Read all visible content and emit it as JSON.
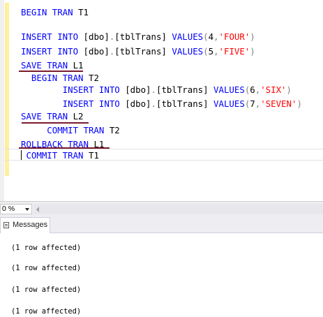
{
  "editor": {
    "lines": [
      {
        "tokens": [
          {
            "t": "BEGIN TRAN",
            "c": "kw"
          },
          {
            "t": " T1",
            "c": "obj"
          }
        ]
      },
      {
        "tokens": [
          {
            "t": "INSERT INTO",
            "c": "kw"
          },
          {
            "t": " [dbo]",
            "c": "obj"
          },
          {
            "t": ".",
            "c": "punc"
          },
          {
            "t": "[tblTrans] ",
            "c": "obj"
          },
          {
            "t": "VALUES",
            "c": "kw"
          },
          {
            "t": "(",
            "c": "punc"
          },
          {
            "t": "4",
            "c": "num"
          },
          {
            "t": ",",
            "c": "punc"
          },
          {
            "t": "'FOUR'",
            "c": "str"
          },
          {
            "t": ")",
            "c": "punc"
          }
        ]
      },
      {
        "tokens": [
          {
            "t": "INSERT INTO",
            "c": "kw"
          },
          {
            "t": " [dbo]",
            "c": "obj"
          },
          {
            "t": ".",
            "c": "punc"
          },
          {
            "t": "[tblTrans] ",
            "c": "obj"
          },
          {
            "t": "VALUES",
            "c": "kw"
          },
          {
            "t": "(",
            "c": "punc"
          },
          {
            "t": "5",
            "c": "num"
          },
          {
            "t": ",",
            "c": "punc"
          },
          {
            "t": "'FIVE'",
            "c": "str"
          },
          {
            "t": ")",
            "c": "punc"
          }
        ]
      },
      {
        "tokens": [
          {
            "t": "SAVE TRAN",
            "c": "kw"
          },
          {
            "t": " L1",
            "c": "obj"
          }
        ]
      },
      {
        "tokens": [
          {
            "t": "  BEGIN TRAN",
            "c": "kw"
          },
          {
            "t": " T2",
            "c": "obj"
          }
        ]
      },
      {
        "tokens": [
          {
            "t": "        INSERT INTO",
            "c": "kw"
          },
          {
            "t": " [dbo]",
            "c": "obj"
          },
          {
            "t": ".",
            "c": "punc"
          },
          {
            "t": "[tblTrans] ",
            "c": "obj"
          },
          {
            "t": "VALUES",
            "c": "kw"
          },
          {
            "t": "(",
            "c": "punc"
          },
          {
            "t": "6",
            "c": "num"
          },
          {
            "t": ",",
            "c": "punc"
          },
          {
            "t": "'SIX'",
            "c": "str"
          },
          {
            "t": ")",
            "c": "punc"
          }
        ]
      },
      {
        "tokens": [
          {
            "t": "        INSERT INTO",
            "c": "kw"
          },
          {
            "t": " [dbo]",
            "c": "obj"
          },
          {
            "t": ".",
            "c": "punc"
          },
          {
            "t": "[tblTrans] ",
            "c": "obj"
          },
          {
            "t": "VALUES",
            "c": "kw"
          },
          {
            "t": "(",
            "c": "punc"
          },
          {
            "t": "7",
            "c": "num"
          },
          {
            "t": ",",
            "c": "punc"
          },
          {
            "t": "'SEVEN'",
            "c": "str"
          },
          {
            "t": ")",
            "c": "punc"
          }
        ]
      },
      {
        "tokens": [
          {
            "t": "SAVE TRAN",
            "c": "kw"
          },
          {
            "t": " L2",
            "c": "obj"
          }
        ]
      },
      {
        "tokens": [
          {
            "t": "     COMMIT TRAN",
            "c": "kw"
          },
          {
            "t": " T2",
            "c": "obj"
          }
        ]
      },
      {
        "tokens": [
          {
            "t": "ROLLBACK TRAN",
            "c": "kw"
          },
          {
            "t": " L1",
            "c": "obj"
          }
        ]
      },
      {
        "tokens": [
          {
            "t": " COMMIT TRAN",
            "c": "kw"
          },
          {
            "t": " T1",
            "c": "obj"
          }
        ]
      }
    ],
    "annotation_color": "#7a1a2e",
    "keyword_color": "#0000ff",
    "string_color": "#ff0000"
  },
  "zoom": {
    "value": "0 %"
  },
  "results_tabs": [
    {
      "label": "Messages",
      "icon": "messages-icon"
    }
  ],
  "messages": [
    "(1 row affected)",
    "(1 row affected)",
    "(1 row affected)",
    "(1 row affected)"
  ]
}
